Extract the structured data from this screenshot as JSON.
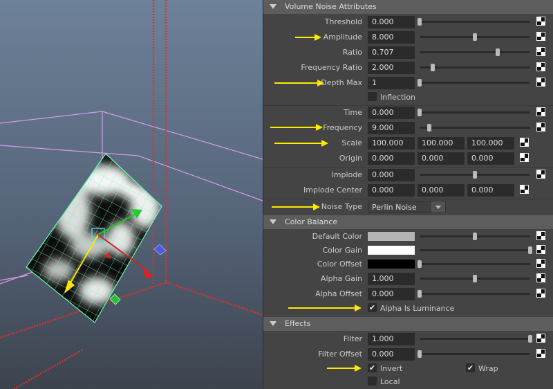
{
  "viewport": {},
  "sections": {
    "volume_noise": "Volume Noise Attributes",
    "color_balance": "Color Balance",
    "effects": "Effects"
  },
  "volume_noise": {
    "threshold": {
      "label": "Threshold",
      "value": "0.000",
      "slider": 0.0
    },
    "amplitude": {
      "label": "Amplitude",
      "value": "8.000",
      "slider": 0.5
    },
    "ratio": {
      "label": "Ratio",
      "value": "0.707",
      "slider": 0.707
    },
    "frequency_ratio": {
      "label": "Frequency Ratio",
      "value": "2.000",
      "slider": 0.12
    },
    "depth_max": {
      "label": "Depth Max",
      "value": "1",
      "slider": 0.0
    },
    "inflection": {
      "label": "Inflection",
      "checked": false
    },
    "time": {
      "label": "Time",
      "value": "0.000",
      "slider": 0.0
    },
    "frequency": {
      "label": "Frequency",
      "value": "9.000",
      "slider": 0.09
    },
    "scale": {
      "label": "Scale",
      "x": "100.000",
      "y": "100.000",
      "z": "100.000"
    },
    "origin": {
      "label": "Origin",
      "x": "0.000",
      "y": "0.000",
      "z": "0.000"
    },
    "implode": {
      "label": "Implode",
      "value": "0.000",
      "slider": 0.5
    },
    "implode_center": {
      "label": "Implode Center",
      "x": "0.000",
      "y": "0.000",
      "z": "0.000"
    },
    "noise_type": {
      "label": "Noise Type",
      "value": "Perlin Noise"
    }
  },
  "color_balance": {
    "default_color": {
      "label": "Default Color",
      "color": "#b4b4b4",
      "slider": 0.5
    },
    "color_gain": {
      "label": "Color Gain",
      "color": "#ffffff",
      "slider": 1.0
    },
    "color_offset": {
      "label": "Color Offset",
      "color": "#000000",
      "slider": 0.0
    },
    "alpha_gain": {
      "label": "Alpha Gain",
      "value": "1.000",
      "slider": 0.5
    },
    "alpha_offset": {
      "label": "Alpha Offset",
      "value": "0.000",
      "slider": 0.0
    },
    "alpha_is_luminance": {
      "label": "Alpha Is Luminance",
      "checked": true
    }
  },
  "effects": {
    "filter": {
      "label": "Filter",
      "value": "1.000",
      "slider": 1.0
    },
    "filter_offset": {
      "label": "Filter Offset",
      "value": "0.000",
      "slider": 0.0
    },
    "invert": {
      "label": "Invert",
      "checked": true
    },
    "wrap": {
      "label": "Wrap",
      "checked": true
    },
    "local": {
      "label": "Local",
      "checked": false
    }
  },
  "colors": {
    "panel_bg": "#444444",
    "header_bg": "#5d5d5d",
    "field_bg": "#2b2b2b",
    "annotation_arrow": "#ffea00",
    "viewport_bg_top": "#6b7f95",
    "viewport_bg_bottom": "#3e4650",
    "grid_red": "#e0302f",
    "manipulator_wire": "#5fffb0"
  },
  "icons": {
    "map_button": "checker-map-icon",
    "section_toggle": "triangle-down-icon",
    "checkbox": "check-icon"
  }
}
